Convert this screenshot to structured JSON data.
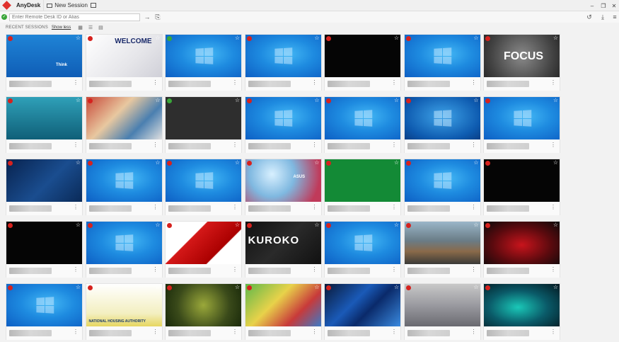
{
  "titlebar": {
    "app_name": "AnyDesk",
    "tab_new_session": "New Session"
  },
  "toolbar": {
    "address_placeholder": "Enter Remote Desk ID or Alias"
  },
  "section": {
    "label": "RECENT SESSIONS",
    "toggle_link": "Show less"
  },
  "sessions": [
    {
      "status": "red",
      "bg": "bg-think",
      "text": "Think"
    },
    {
      "status": "red",
      "bg": "bg-welcome",
      "text": "WELCOME"
    },
    {
      "status": "green",
      "bg": "bg-win10",
      "text": ""
    },
    {
      "status": "red",
      "bg": "bg-win10",
      "text": ""
    },
    {
      "status": "red",
      "bg": "bg-black",
      "text": ""
    },
    {
      "status": "red",
      "bg": "bg-win10",
      "text": ""
    },
    {
      "status": "red",
      "bg": "bg-focus",
      "text": "FOCUS"
    },
    {
      "status": "red",
      "bg": "bg-ocean",
      "text": ""
    },
    {
      "status": "red",
      "bg": "bg-collage",
      "text": ""
    },
    {
      "status": "green",
      "bg": "bg-dark",
      "text": ""
    },
    {
      "status": "red",
      "bg": "bg-win10",
      "text": ""
    },
    {
      "status": "red",
      "bg": "bg-win10",
      "text": ""
    },
    {
      "status": "red",
      "bg": "bg-win7",
      "text": ""
    },
    {
      "status": "red",
      "bg": "bg-win10",
      "text": ""
    },
    {
      "status": "red",
      "bg": "bg-lenovo",
      "text": ""
    },
    {
      "status": "red",
      "bg": "bg-win10",
      "text": ""
    },
    {
      "status": "red",
      "bg": "bg-win10",
      "text": ""
    },
    {
      "status": "red",
      "bg": "bg-asus",
      "text": "ASUS"
    },
    {
      "status": "red",
      "bg": "bg-green",
      "text": ""
    },
    {
      "status": "red",
      "bg": "bg-win10",
      "text": ""
    },
    {
      "status": "red",
      "bg": "bg-black",
      "text": ""
    },
    {
      "status": "red",
      "bg": "bg-black",
      "text": ""
    },
    {
      "status": "red",
      "bg": "bg-win10",
      "text": ""
    },
    {
      "status": "red",
      "bg": "bg-redwave",
      "text": ""
    },
    {
      "status": "red",
      "bg": "bg-kuroko",
      "text": "KUROKO"
    },
    {
      "status": "red",
      "bg": "bg-win10",
      "text": ""
    },
    {
      "status": "red",
      "bg": "bg-rock",
      "text": ""
    },
    {
      "status": "red",
      "bg": "bg-redsplash",
      "text": ""
    },
    {
      "status": "red",
      "bg": "bg-win10",
      "text": ""
    },
    {
      "status": "red",
      "bg": "bg-nha",
      "text": "NATIONAL HOUSING AUTHORITY"
    },
    {
      "status": "red",
      "bg": "bg-tulip",
      "text": ""
    },
    {
      "status": "red",
      "bg": "bg-kids",
      "text": ""
    },
    {
      "status": "red",
      "bg": "bg-bluestripe",
      "text": ""
    },
    {
      "status": "red",
      "bg": "bg-group",
      "text": ""
    },
    {
      "status": "red",
      "bg": "bg-tealblob",
      "text": ""
    }
  ],
  "colors": {
    "brand": "#e0312d",
    "online": "#3aa63a",
    "offline": "#d6221e"
  }
}
